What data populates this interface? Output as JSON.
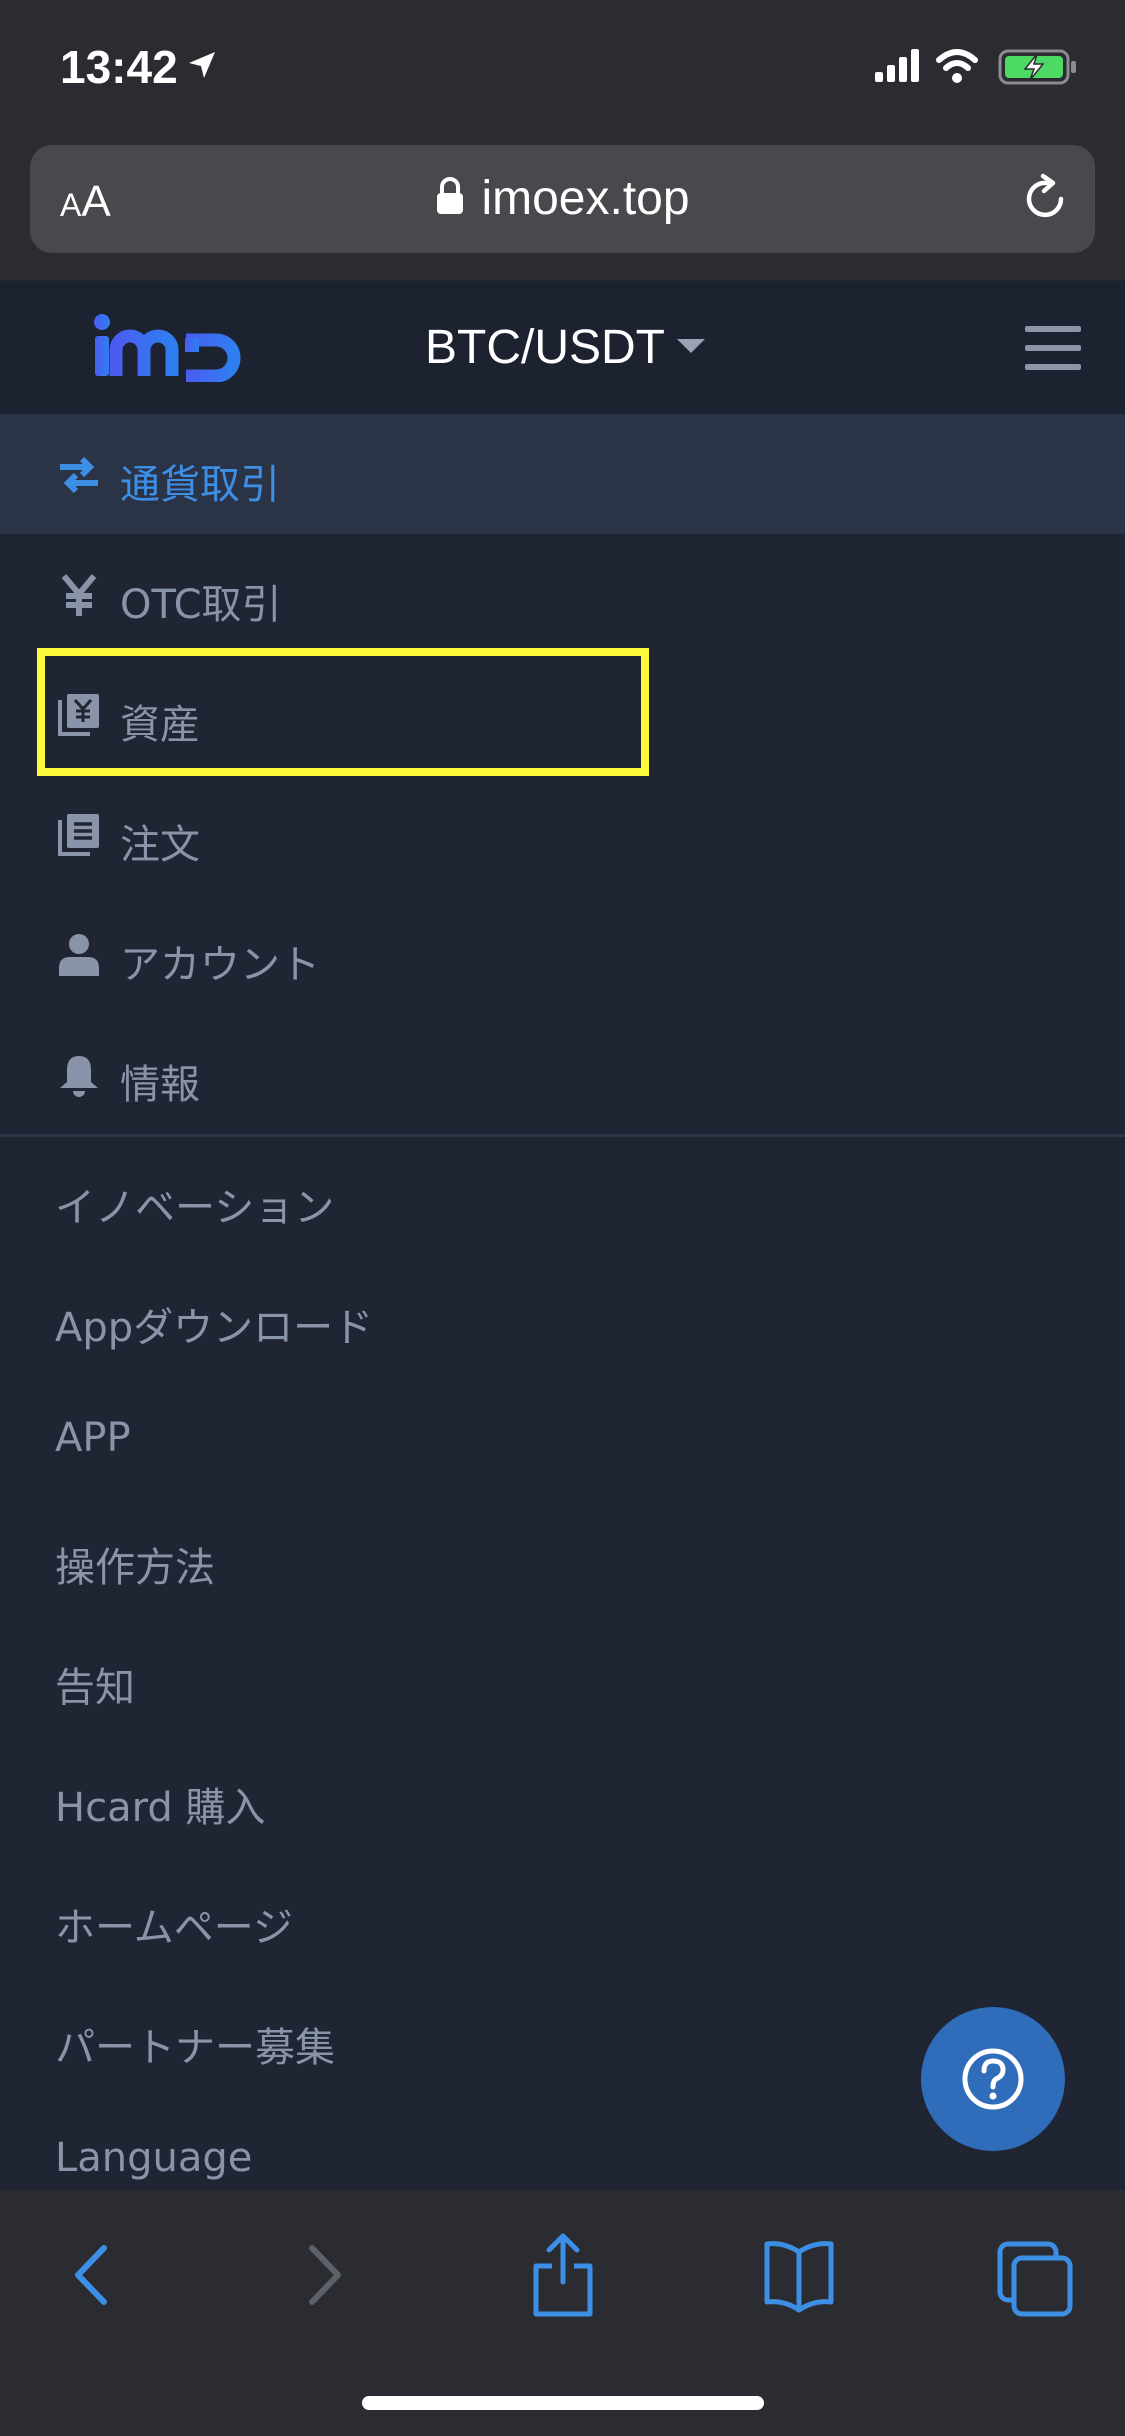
{
  "status": {
    "time": "13:42"
  },
  "browser": {
    "text_size_label_small": "A",
    "text_size_label_large": "A",
    "url": "imoex.top"
  },
  "header": {
    "logo_text": "imo",
    "pair": "BTC/USDT"
  },
  "menu": {
    "primary": [
      {
        "label": "通貨取引",
        "icon": "exchange-arrows-icon",
        "active": true
      },
      {
        "label": "OTC取引",
        "icon": "yen-icon",
        "active": false
      },
      {
        "label": "資産",
        "icon": "asset-book-icon",
        "active": false
      },
      {
        "label": "注文",
        "icon": "orders-icon",
        "active": false
      },
      {
        "label": "アカウント",
        "icon": "user-icon",
        "active": false
      },
      {
        "label": "情報",
        "icon": "bell-icon",
        "active": false
      }
    ],
    "secondary": [
      {
        "label": "イノベーション"
      },
      {
        "label": "Appダウンロード"
      },
      {
        "label": "APP"
      },
      {
        "label": "操作方法"
      },
      {
        "label": "告知"
      },
      {
        "label": "Hcard 購入"
      },
      {
        "label": "ホームページ"
      },
      {
        "label": "パートナー募集"
      },
      {
        "label": "Language"
      }
    ]
  },
  "colors": {
    "background": "#1f2533",
    "active": "#3d8fe6",
    "highlight": "#fbfb3c",
    "help_button": "#2f6dba"
  }
}
